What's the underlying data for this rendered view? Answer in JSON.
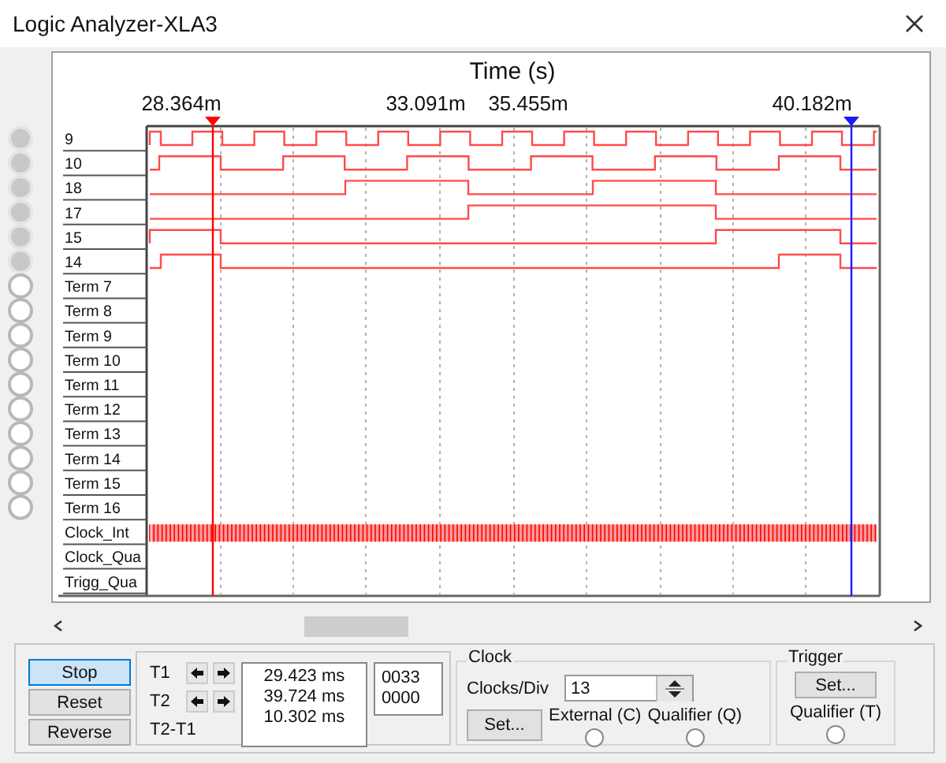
{
  "window": {
    "title": "Logic Analyzer-XLA3"
  },
  "plot": {
    "axis_title": "Time (s)",
    "time_labels": [
      "28.364m",
      "33.091m",
      "35.455m",
      "40.182m"
    ],
    "channels": [
      {
        "label": "9",
        "kind": "probe",
        "connected": true
      },
      {
        "label": "10",
        "kind": "probe",
        "connected": true
      },
      {
        "label": "18",
        "kind": "probe",
        "connected": true
      },
      {
        "label": "17",
        "kind": "probe",
        "connected": true
      },
      {
        "label": "15",
        "kind": "probe",
        "connected": true
      },
      {
        "label": "14",
        "kind": "probe",
        "connected": true
      },
      {
        "label": "Term 7",
        "kind": "probe",
        "connected": false
      },
      {
        "label": "Term 8",
        "kind": "probe",
        "connected": false
      },
      {
        "label": "Term 9",
        "kind": "probe",
        "connected": false
      },
      {
        "label": "Term 10",
        "kind": "probe",
        "connected": false
      },
      {
        "label": "Term 11",
        "kind": "probe",
        "connected": false
      },
      {
        "label": "Term 12",
        "kind": "probe",
        "connected": false
      },
      {
        "label": "Term 13",
        "kind": "probe",
        "connected": false
      },
      {
        "label": "Term 14",
        "kind": "probe",
        "connected": false
      },
      {
        "label": "Term 15",
        "kind": "probe",
        "connected": false
      },
      {
        "label": "Term 16",
        "kind": "probe",
        "connected": false
      },
      {
        "label": "Clock_Int",
        "kind": "clock"
      },
      {
        "label": "Clock_Qua",
        "kind": "line"
      },
      {
        "label": "Trigg_Qua",
        "kind": "line"
      }
    ]
  },
  "buttons": [
    {
      "label": "Stop",
      "selected": true
    },
    {
      "label": "Reset",
      "selected": false
    },
    {
      "label": "Reverse",
      "selected": false
    }
  ],
  "cursors": [
    {
      "label": "T1",
      "time": "29.423 ms",
      "value": "0033"
    },
    {
      "label": "T2",
      "time": "39.724 ms",
      "value": "0000"
    }
  ],
  "difference": {
    "label": "T2-T1",
    "time": "10.302 ms"
  },
  "clock": {
    "title": "Clock",
    "clocks_div_label": "Clocks/Div",
    "clocks_div": "13",
    "set": "Set...",
    "options": [
      {
        "label": "External (C)",
        "selected": false
      },
      {
        "label": "Qualifier (Q)",
        "selected": false
      }
    ]
  },
  "trigger": {
    "title": "Trigger",
    "set": "Set...",
    "qualifier": {
      "label": "Qualifier (T)",
      "selected": false
    }
  }
}
